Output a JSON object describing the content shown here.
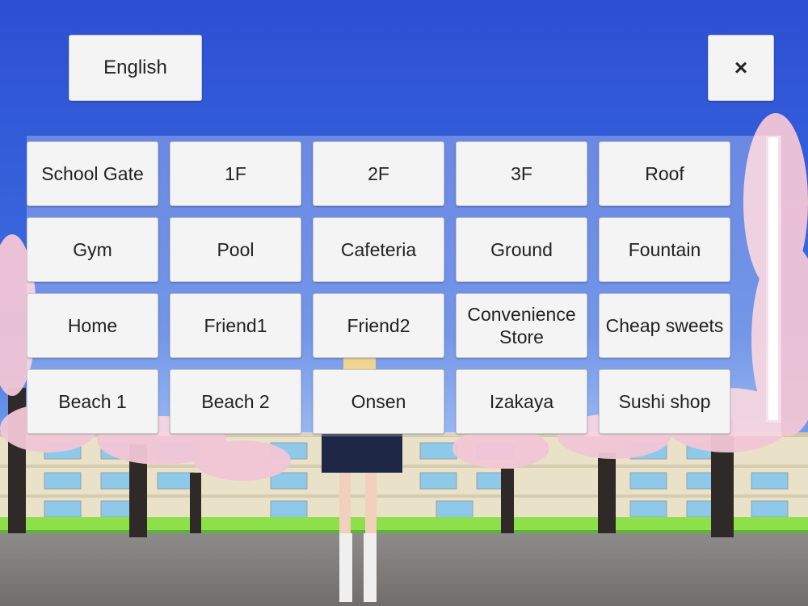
{
  "header": {
    "language_label": "English",
    "close_label": "×"
  },
  "locations": [
    "School Gate",
    "1F",
    "2F",
    "3F",
    "Roof",
    "Gym",
    "Pool",
    "Cafeteria",
    "Ground",
    "Fountain",
    "Home",
    "Friend1",
    "Friend2",
    "Convenience Store",
    "Cheap sweets",
    "Beach 1",
    "Beach 2",
    "Onsen",
    "Izakaya",
    "Sushi shop"
  ],
  "colors": {
    "sky": "#2f55d6",
    "button_bg": "#f4f4f4",
    "blossom": "#f3c6d6"
  }
}
